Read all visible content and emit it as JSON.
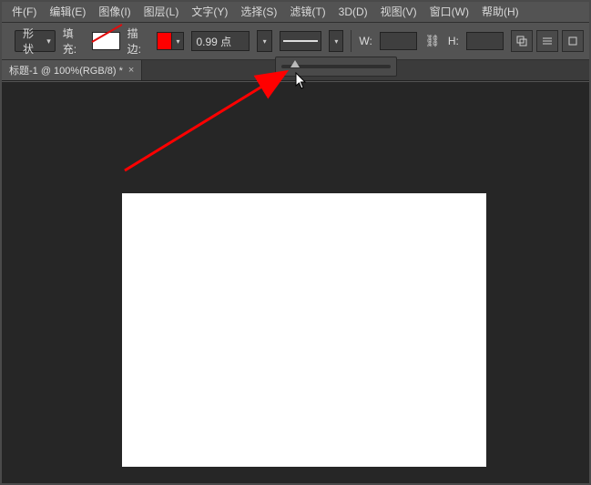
{
  "menu": {
    "file": "件(F)",
    "edit": "编辑(E)",
    "image": "图像(I)",
    "layer": "图层(L)",
    "type": "文字(Y)",
    "select": "选择(S)",
    "filter": "滤镜(T)",
    "threeD": "3D(D)",
    "view": "视图(V)",
    "window": "窗口(W)",
    "help": "帮助(H)"
  },
  "options": {
    "shapeMode": "形状",
    "fillLabel": "填充:",
    "strokeLabel": "描边:",
    "strokeWidth": "0.99 点",
    "wLabel": "W:",
    "hLabel": "H:"
  },
  "tab": {
    "title": "标题-1 @ 100%(RGB/8) *",
    "closeGlyph": "×"
  },
  "icons": {
    "chevDown": "▾",
    "link": "⛓"
  }
}
